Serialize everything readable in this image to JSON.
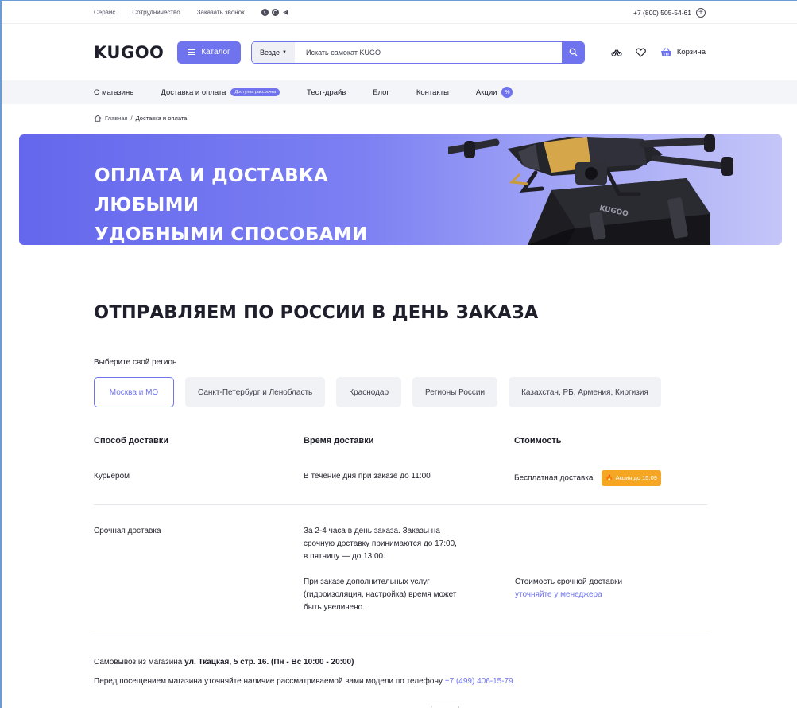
{
  "topbar": {
    "links": [
      "Сервис",
      "Сотрудничество",
      "Заказать звонок"
    ],
    "social_icons": [
      "viber-icon",
      "whatsapp-icon",
      "telegram-icon"
    ],
    "phone": "+7 (800) 505-54-61"
  },
  "header": {
    "logo": "KUGOO",
    "catalog_label": "Каталог",
    "search_scope": "Везде",
    "search_placeholder": "Искать самокат KUGO",
    "cart_label": "Корзина"
  },
  "nav": {
    "items": [
      {
        "label": "О магазине"
      },
      {
        "label": "Доставка и оплата",
        "badge": "Доступна рассрочка"
      },
      {
        "label": "Тест-драйв"
      },
      {
        "label": "Блог"
      },
      {
        "label": "Контакты"
      },
      {
        "label": "Акции",
        "badge": "%"
      }
    ]
  },
  "breadcrumb": {
    "home": "Главная",
    "separator": "/",
    "current": "Доставка и оплата"
  },
  "banner": {
    "title_line1": "ОПЛАТА И ДОСТАВКА ЛЮБЫМИ",
    "title_line2": "УДОБНЫМИ СПОСОБАМИ",
    "drone_brand": "KUGOO",
    "gradient_start": "#6467ec",
    "gradient_end": "#c4c5f8"
  },
  "delivery": {
    "title": "ОТПРАВЛЯЕМ ПО РОССИИ В ДЕНЬ ЗАКАЗА",
    "region_label": "Выберите свой регион",
    "regions": [
      "Москва и МО",
      "Санкт-Петербург и Ленобласть",
      "Краснодар",
      "Регионы России",
      "Казахстан, РБ, Армения, Киргизия"
    ],
    "active_region": "Москва и МО",
    "columns": [
      "Способ доставки",
      "Время доставки",
      "Стоимость"
    ],
    "rows": [
      {
        "method": "Курьером",
        "time": "В течение дня при заказе до 11:00",
        "cost": "Бесплатная доставка",
        "promo": "Акция до 15.09"
      },
      {
        "method": "Срочная доставка",
        "time_lines": [
          "За 2-4 часа в день заказа. Заказы на",
          "срочную доставку принимаются до 17:00,",
          "в пятницу — до 13:00."
        ],
        "time_note_lines": [
          "При заказе дополнительных услуг",
          "(гидроизоляция, настройка) время может",
          "быть увеличено."
        ],
        "cost": "Стоимость срочной доставки",
        "cost_link": "уточняйте у менеджера"
      }
    ],
    "pickup_prefix": "Самовывоз из магазина",
    "pickup_address": "ул. Ткацкая, 5 стр. 16.  (Пн - Вс 10:00 - 20:00)",
    "visit_text": "Перед посещением магазина уточняйте  наличие рассматриваемой вами модели по телефону",
    "visit_phone": "+7 (499) 406-15-79"
  },
  "colors": {
    "accent": "#6f73ee",
    "promo": "#f5a623",
    "nav_bg": "#f4f5f9"
  }
}
